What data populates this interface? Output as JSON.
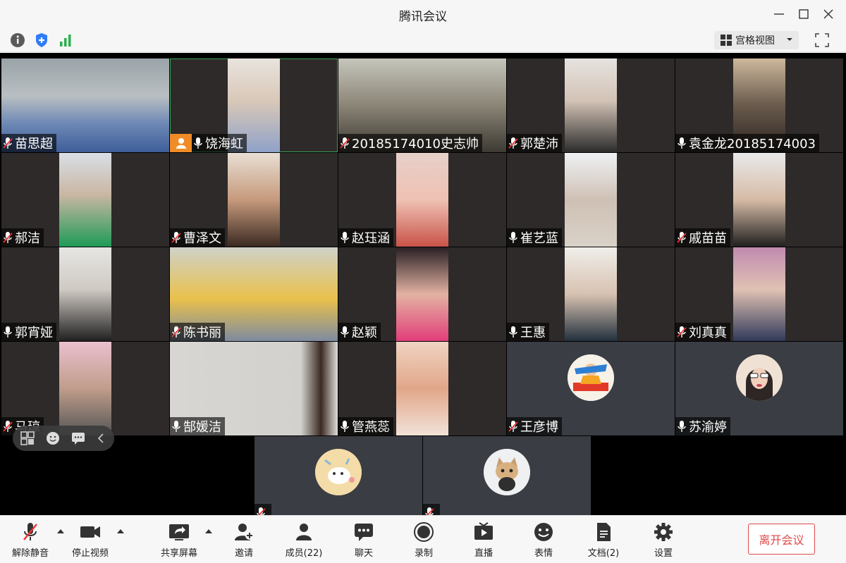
{
  "window": {
    "title": "腾讯会议"
  },
  "topbar": {
    "view_label": "宫格视图"
  },
  "participants": [
    {
      "name": "苗思超"
    },
    {
      "name": "饶海虹"
    },
    {
      "name": "20185174010史志帅"
    },
    {
      "name": "郭楚沛"
    },
    {
      "name": "袁金龙20185174003"
    },
    {
      "name": "郝洁"
    },
    {
      "name": "曹泽文"
    },
    {
      "name": "赵珏涵"
    },
    {
      "name": "崔艺蓝"
    },
    {
      "name": "戚苗苗"
    },
    {
      "name": "郭宵娅"
    },
    {
      "name": "陈书丽"
    },
    {
      "name": "赵颖"
    },
    {
      "name": "王惠"
    },
    {
      "name": "刘真真"
    },
    {
      "name": "马琼"
    },
    {
      "name": "郜媛洁"
    },
    {
      "name": "管燕蕊"
    },
    {
      "name": "王彦博"
    },
    {
      "name": "苏渝婷"
    }
  ],
  "bottom_tiles": [
    {
      "name": ""
    },
    {
      "name": ""
    }
  ],
  "controls": {
    "unmute": "解除静音",
    "stop_video": "停止视频",
    "share": "共享屏幕",
    "invite": "邀请",
    "members": "成员(22)",
    "chat": "聊天",
    "record": "录制",
    "live": "直播",
    "emoji": "表情",
    "docs": "文档(2)",
    "settings": "设置",
    "leave": "离开会议"
  },
  "colors": {
    "accent_green": "#3aa55a",
    "host_badge": "#f08c28",
    "leave_red": "#e14848",
    "shield_blue": "#2f7cf6",
    "signal_green": "#2bb24c"
  }
}
